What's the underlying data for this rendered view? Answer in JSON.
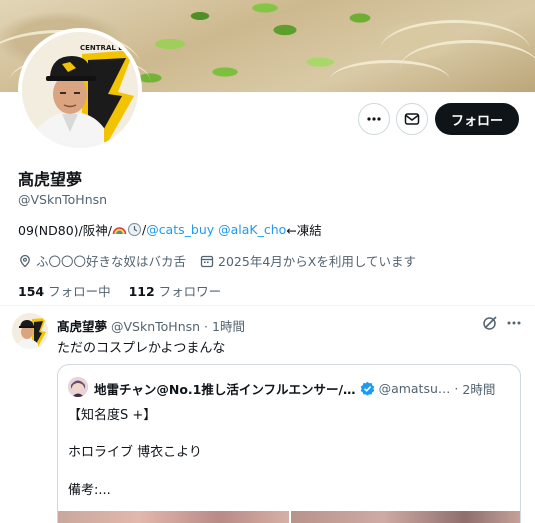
{
  "profile": {
    "display_name": "髙虎望夢",
    "handle": "@VSknToHnsn",
    "bio": {
      "prefix": "09(ND80)/阪神/",
      "slash": "/",
      "link1": "@cats_buy",
      "space": " ",
      "link2": "@alaK_cho",
      "suffix": "←凍結"
    },
    "location": "ふ〇〇〇好きな奴はバカ舌",
    "joined": "2025年4月からXを利用しています",
    "following_count": "154",
    "following_label": "フォロー中",
    "followers_count": "112",
    "followers_label": "フォロワー",
    "avatar_logo_text": "CENTRAL LEAGUE"
  },
  "actions": {
    "more_icon": "more-horizontal-icon",
    "message_icon": "envelope-icon",
    "follow_label": "フォロー"
  },
  "tweet": {
    "author_name": "髙虎望夢",
    "author_handle": "@VSknToHnsn",
    "separator": "·",
    "time": "1時間",
    "text": "ただのコスプレかよつまんな",
    "quote": {
      "author_name": "地雷チャン@No.1推し活インフルエンサー/…",
      "author_handle": "@amatsu…",
      "separator": "·",
      "time": "2時間",
      "line1": "【知名度S +】",
      "line2": "ホロライブ 博衣こより",
      "line3": "備考:..."
    }
  },
  "colors": {
    "accent_link": "#1d9bf0",
    "secondary_text": "#536471",
    "follow_button_bg": "#0f1419",
    "verified_badge": "#1d9bf0"
  }
}
